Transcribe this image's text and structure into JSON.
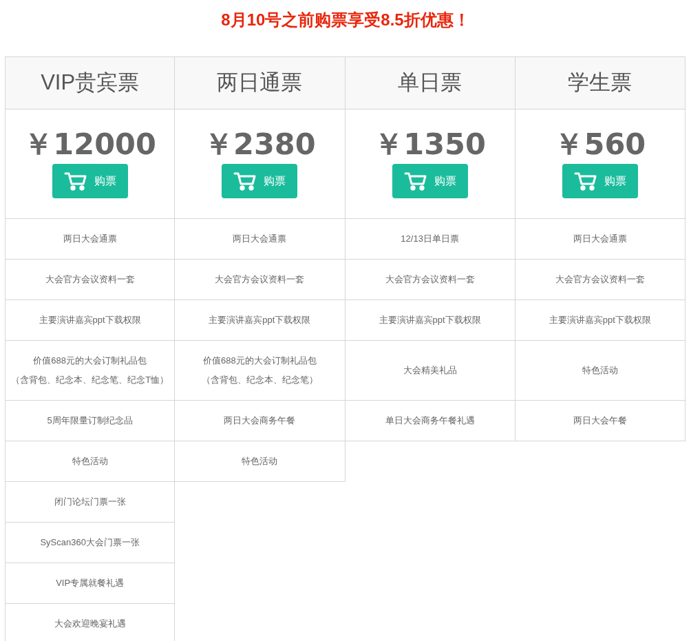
{
  "banner": "8月10号之前购票享受8.5折优惠！",
  "tickets": [
    {
      "name": "VIP贵宾票",
      "price": "￥12000",
      "button": "购票",
      "features": [
        "两日大会通票",
        "大会官方会议资料一套",
        "主要演讲嘉宾ppt下载权限",
        [
          "价值688元的大会订制礼品包",
          "（含背包、纪念本、纪念笔、纪念T恤）"
        ],
        "5周年限量订制纪念品",
        "特色活动",
        "闭门论坛门票一张",
        "SyScan360大会门票一张",
        "VIP专属就餐礼遇",
        "大会欢迎晚宴礼遇"
      ]
    },
    {
      "name": "两日通票",
      "price": "￥2380",
      "button": "购票",
      "features": [
        "两日大会通票",
        "大会官方会议资料一套",
        "主要演讲嘉宾ppt下载权限",
        [
          "价值688元的大会订制礼品包",
          "（含背包、纪念本、纪念笔）"
        ],
        "两日大会商务午餐",
        "特色活动"
      ]
    },
    {
      "name": "单日票",
      "price": "￥1350",
      "button": "购票",
      "features": [
        "12/13日单日票",
        "大会官方会议资料一套",
        "主要演讲嘉宾ppt下载权限",
        "大会精美礼品",
        "单日大会商务午餐礼遇"
      ]
    },
    {
      "name": "学生票",
      "price": "￥560",
      "button": "购票",
      "features": [
        "两日大会通票",
        "大会官方会议资料一套",
        "主要演讲嘉宾ppt下载权限",
        "特色活动",
        "两日大会午餐"
      ]
    }
  ]
}
